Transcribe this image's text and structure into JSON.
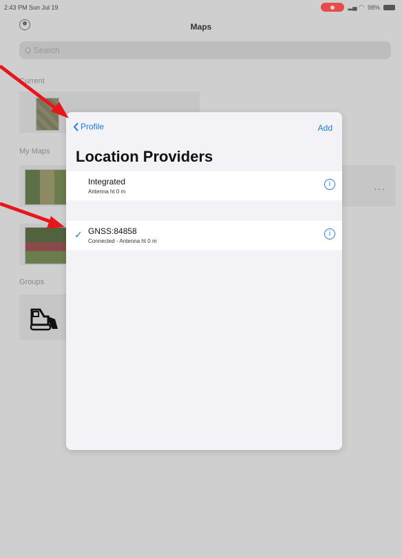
{
  "status_bar": {
    "time": "2:43 PM  Sun Jul 19",
    "battery": "98%"
  },
  "header": {
    "title": "Maps"
  },
  "search": {
    "placeholder": "Q Search"
  },
  "sections": {
    "current": "Current",
    "my_maps": "My Maps",
    "groups": "Groups"
  },
  "modal": {
    "back_label": "Profile",
    "add_label": "Add",
    "title": "Location Providers",
    "providers": [
      {
        "name": "Integrated",
        "detail": "Antenna ht 0 m",
        "selected": false
      },
      {
        "name": "GNSS:84858",
        "detail": "Connected - Antenna ht 0 m",
        "selected": true
      }
    ]
  },
  "colors": {
    "accent": "#1e7ae0",
    "annotation_arrow": "#e8161b"
  }
}
